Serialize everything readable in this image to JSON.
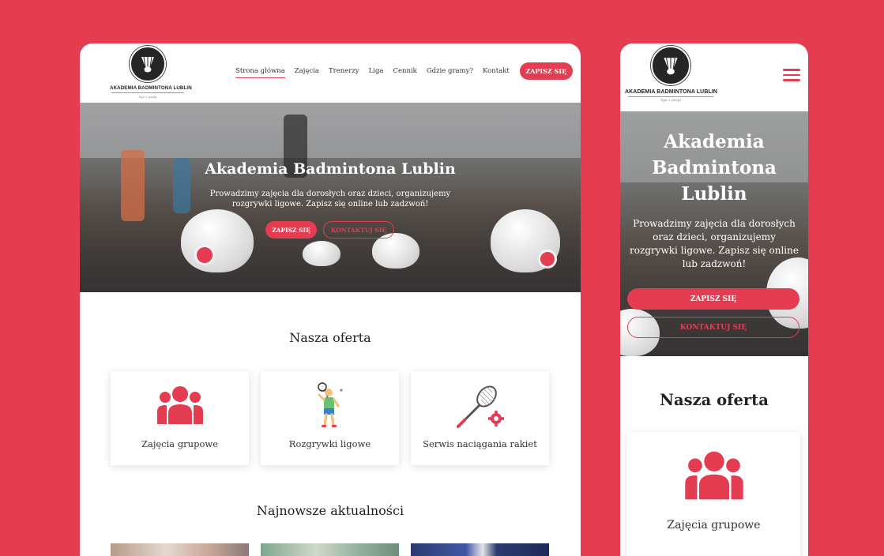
{
  "brand": {
    "name": "AKADEMIA BADMINTONA LUBLIN",
    "tagline": "liga z pasją",
    "accent": "#e43d51"
  },
  "nav": {
    "items": [
      "Strona główna",
      "Zajęcia",
      "Trenerzy",
      "Liga",
      "Cennik",
      "Gdzie gramy?",
      "Kontakt"
    ],
    "cta": "ZAPISZ SIĘ"
  },
  "hero": {
    "title": "Akademia Badmintona Lublin",
    "mobile_title": "Akademia Badmintona Lublin",
    "text": "Prowadzimy zajęcia dla dorosłych oraz dzieci, organizujemy rozgrywki ligowe. Zapisz się online lub zadzwoń!",
    "primary_button": "ZAPISZ SIĘ",
    "secondary_button": "KONTAKTUJ SIĘ"
  },
  "offer": {
    "title": "Nasza oferta",
    "cards": [
      {
        "label": "Zajęcia grupowe",
        "icon": "group-icon"
      },
      {
        "label": "Rozgrywki ligowe",
        "icon": "badminton-player-icon"
      },
      {
        "label": "Serwis naciągania rakiet",
        "icon": "racket-service-icon"
      }
    ]
  },
  "news": {
    "title": "Najnowsze aktualności"
  }
}
